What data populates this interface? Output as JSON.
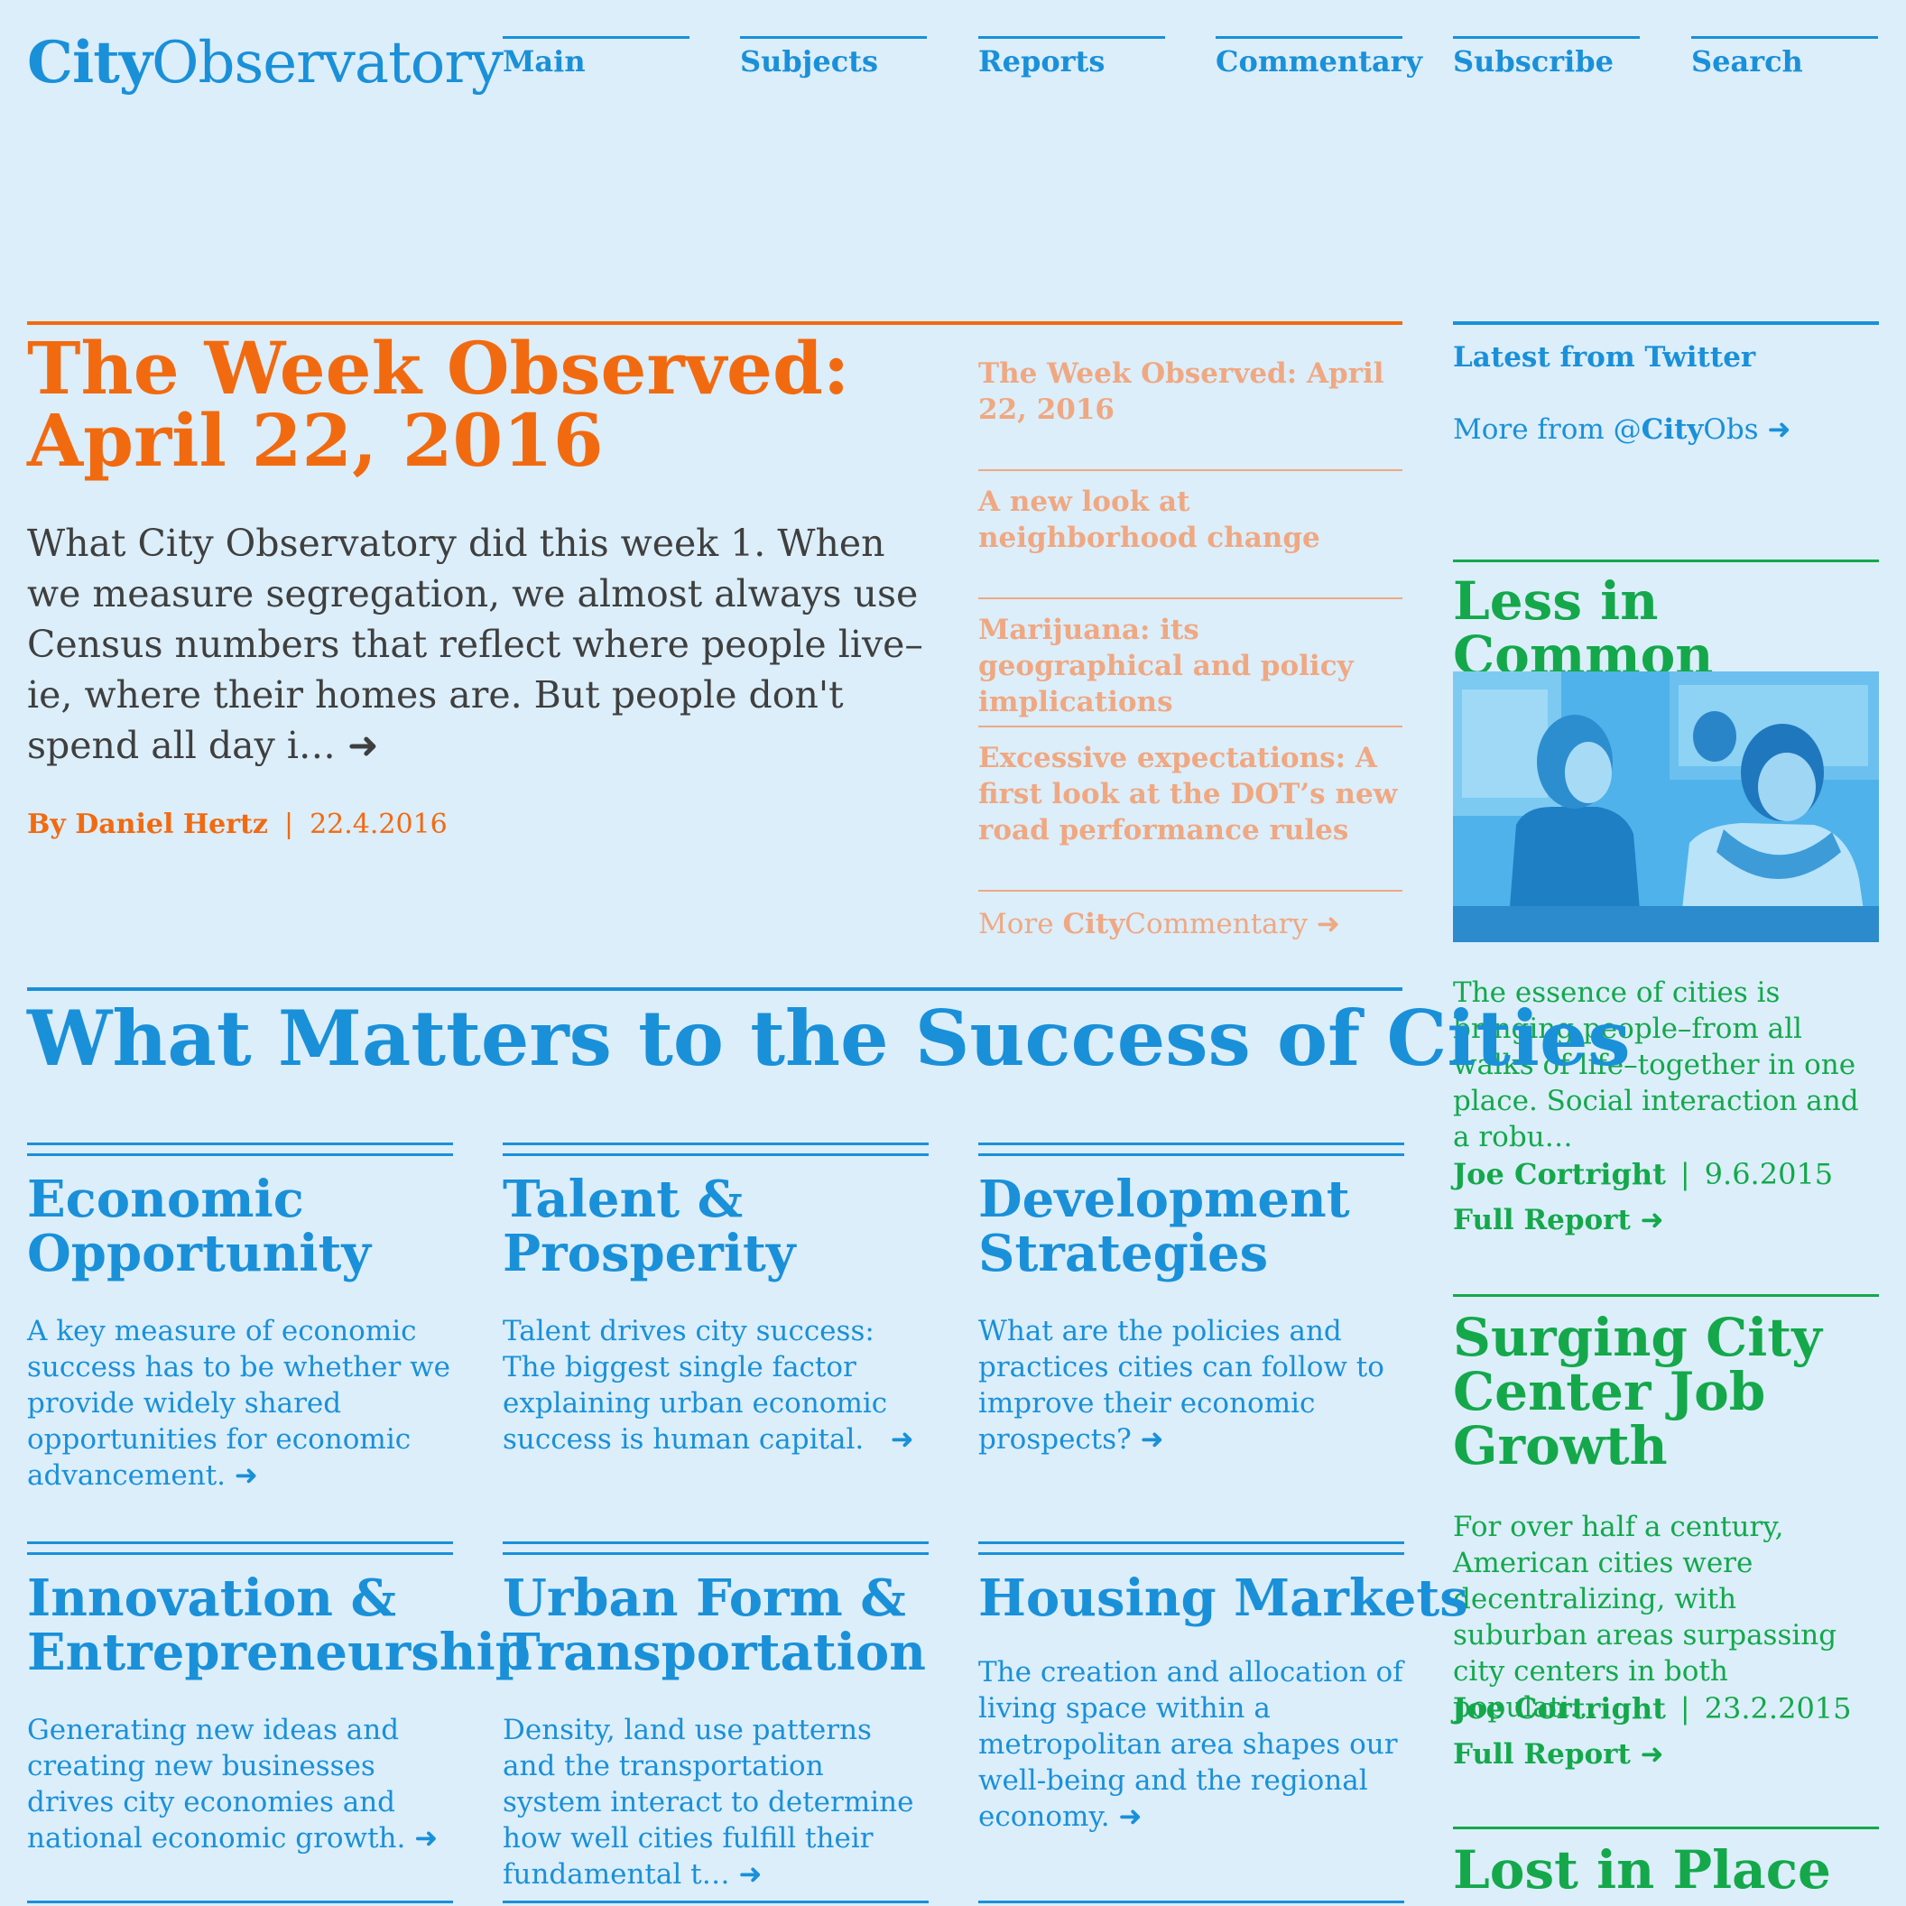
{
  "header": {
    "logo_bold": "City",
    "logo_rest": "Observatory",
    "nav": [
      "Main",
      "Subjects",
      "Reports",
      "Commentary",
      "Subscribe",
      "Search"
    ]
  },
  "featured": {
    "title": "The Week Observed: April 22, 2016",
    "excerpt": "What City Observatory did this week 1. When we measure segregation, we almost always use Census numbers that reflect where people live–ie, where their homes are. But people don't spend all day i…",
    "author": "By Daniel Hertz",
    "separator": "|",
    "date": "22.4.2016"
  },
  "commentary": {
    "items": [
      "The Week Observed: April 22, 2016",
      "A new look at neighborhood change",
      "Marijuana: its geographical and policy implications",
      "Excessive expectations: A first look at the DOT’s new road performance rules"
    ],
    "more_prefix": "More ",
    "more_bold": "City",
    "more_rest": "Commentary"
  },
  "twitter": {
    "title": "Latest from Twitter",
    "more_prefix": "More from @",
    "more_bold": "City",
    "more_rest": "Obs"
  },
  "reports": [
    {
      "title": "Less in Common",
      "excerpt": "The essence of cities is bringing people–from all walks of life–together in one place.  Social interaction and a robu…",
      "author": "Joe Cortright",
      "date": "9.6.2015",
      "full": "Full Report"
    },
    {
      "title": "Surging City Center Job Growth",
      "excerpt": "For over half a century, American cities were decentralizing, with suburban areas surpassing city centers in both populati…",
      "author": "Joe Cortright",
      "date": "23.2.2015",
      "full": "Full Report"
    },
    {
      "title": "Lost in Place"
    }
  ],
  "section": {
    "title": "What Matters to the Success of Cities",
    "cards": [
      {
        "title_1": "Economic",
        "title_2": "Opportunity",
        "text": "A key measure of economic success has to be whether we provide widely shared opportunities for economic advancement."
      },
      {
        "title_1": "Talent &",
        "title_2": "Prosperity",
        "text": "Talent drives city success: The biggest single factor explaining urban economic success is human capital."
      },
      {
        "title_1": "Development",
        "title_2": "Strategies",
        "text": "What are the policies and practices cities can follow to improve their economic prospects?"
      },
      {
        "title_1": "Innovation &",
        "title_2": "Entrepreneurship",
        "text": "Generating new ideas and creating new businesses drives city economies and national economic growth."
      },
      {
        "title_1": "Urban Form &",
        "title_2": "Transportation",
        "text": "Density, land use patterns and the transportation system interact to determine how well cities fulfill their fundamental t…"
      },
      {
        "title_1": "Housing Markets",
        "title_2": "",
        "text": "The creation and allocation of living space within a metropolitan area shapes our well-being and the regional economy."
      }
    ]
  },
  "colors": {
    "background": "#dbeefa",
    "blue": "#1a90d9",
    "orange": "#f26a10",
    "peach": "#f0a882",
    "green": "#14a84b"
  },
  "icons": {
    "arrow": "➜",
    "photo": "subway-passengers-photo"
  }
}
